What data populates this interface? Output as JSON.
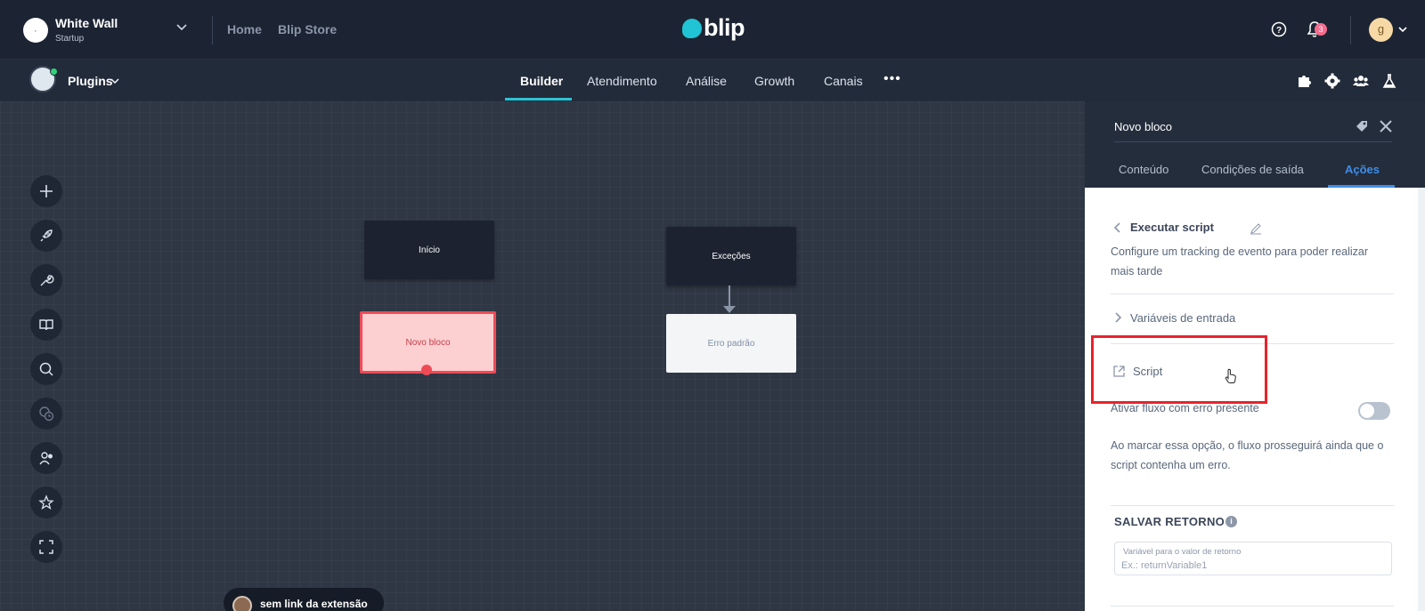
{
  "workspace": {
    "name": "White Wall",
    "plan": "Startup"
  },
  "top_links": [
    "Home",
    "Blip Store"
  ],
  "brand": {
    "name": "blip",
    "accent": "#20c4d4"
  },
  "notifications": {
    "count": "3"
  },
  "user": {
    "initial": "g"
  },
  "bot": {
    "name": "Plugins"
  },
  "nav_tabs": [
    {
      "label": "Builder",
      "active": true
    },
    {
      "label": "Atendimento"
    },
    {
      "label": "Análise"
    },
    {
      "label": "Growth"
    },
    {
      "label": "Canais"
    }
  ],
  "sidebar_tools": [
    "plus-icon",
    "rocket-icon",
    "wrench-icon",
    "book-icon",
    "search-icon",
    "clock-switch-icon",
    "users-icon",
    "star-icon",
    "fullscreen-icon"
  ],
  "blocks": {
    "inicio": "Início",
    "novo_bloco": "Novo bloco",
    "excecoes": "Exceções",
    "erro_padrao": "Erro padrão"
  },
  "extension_pill": {
    "label": "sem link da extensão"
  },
  "panel": {
    "title": "Novo bloco",
    "tabs": [
      {
        "label": "Conteúdo"
      },
      {
        "label": "Condições de saída"
      },
      {
        "label": "Ações",
        "active": true
      }
    ],
    "action_title": "Executar script",
    "description": "Configure um tracking de evento para poder realizar mais tarde",
    "input_variables": "Variáveis de entrada",
    "script_label": "Script",
    "toggle_label": "Ativar fluxo com erro presente",
    "toggle_on": false,
    "toggle_description": "Ao marcar essa opção, o fluxo prosseguirá ainda que o script contenha um erro.",
    "return_heading": "SALVAR RETORNO",
    "return_field": {
      "label": "Variável para o valor de retorno",
      "placeholder": "Ex.: returnVariable1",
      "value": ""
    }
  },
  "colors": {
    "topbar": "#1c2433",
    "canvas": "#2f3744",
    "selected_block": "#fccfd1",
    "selected_border": "#ef4b56",
    "active_tab": "#3f8de8",
    "highlight": "#e8232b"
  }
}
